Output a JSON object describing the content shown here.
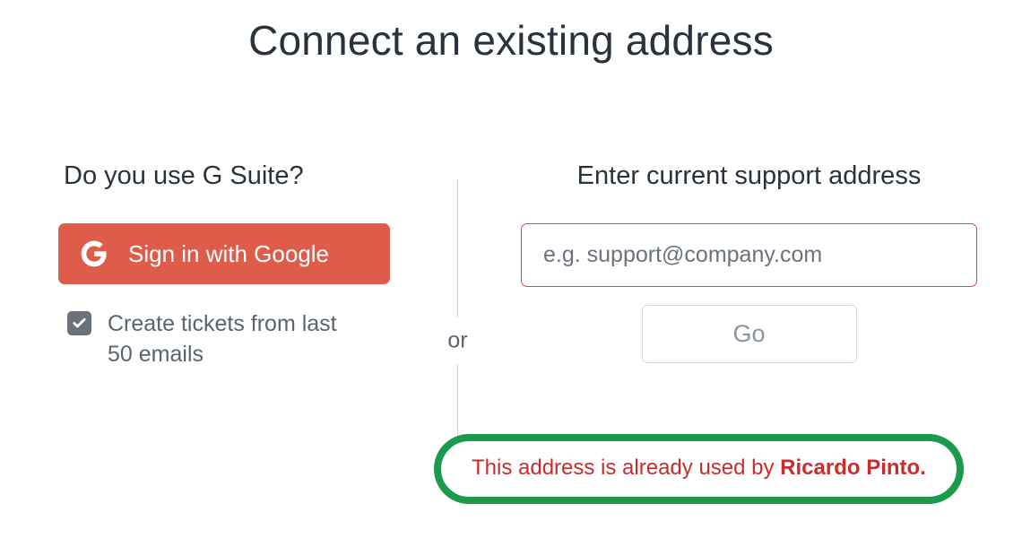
{
  "title": "Connect an existing address",
  "divider_text": "or",
  "left": {
    "heading": "Do you use G Suite?",
    "google_button_label": "Sign in with Google",
    "checkbox_checked": true,
    "checkbox_label": "Create tickets from last 50 emails"
  },
  "right": {
    "heading": "Enter current support address",
    "email_placeholder": "e.g. support@company.com",
    "email_value": "",
    "go_label": "Go",
    "error_prefix": "This address is already used by ",
    "error_user": "Ricardo Pinto."
  }
}
